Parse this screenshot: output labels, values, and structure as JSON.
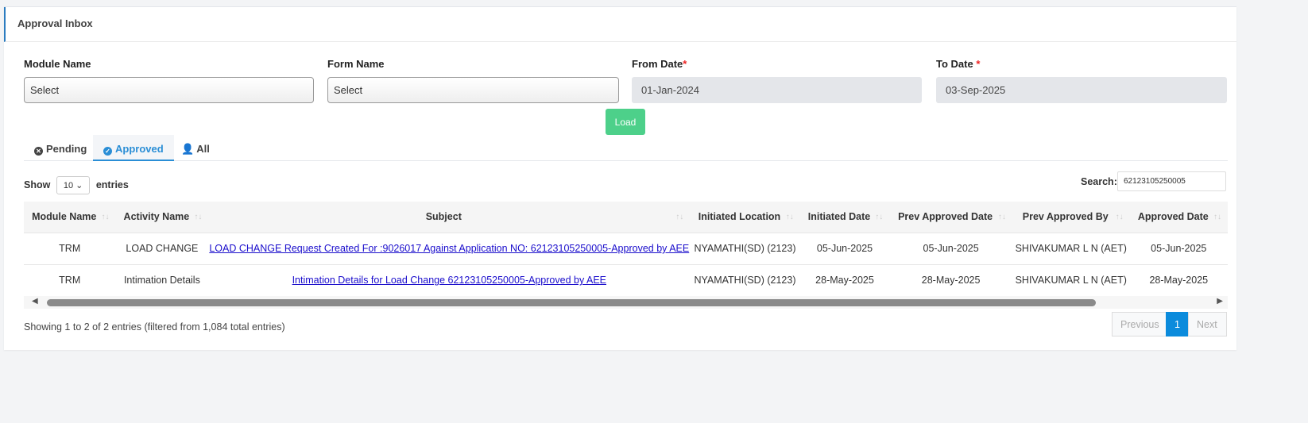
{
  "header": {
    "title": "Approval Inbox"
  },
  "filters": {
    "module_label": "Module Name",
    "module_value": "Select",
    "form_label": "Form Name",
    "form_value": "Select",
    "from_label": "From Date",
    "from_value": "01-Jan-2024",
    "to_label": "To Date",
    "to_value": "03-Sep-2025",
    "required_mark": "*",
    "load_label": "Load"
  },
  "tabs": [
    {
      "label": "Pending",
      "icon": "times-circle-icon"
    },
    {
      "label": "Approved",
      "icon": "check-circle-icon",
      "active": true
    },
    {
      "label": "All",
      "icon": "user-icon"
    }
  ],
  "table_controls": {
    "show_label": "Show",
    "entries_value": "10",
    "entries_label": "entries",
    "search_label": "Search:",
    "search_value": "62123105250005"
  },
  "table": {
    "columns": [
      "Module Name",
      "Activity Name",
      "Subject",
      "Initiated Location",
      "Initiated Date",
      "Prev Approved Date",
      "Prev Approved By",
      "Approved Date"
    ],
    "rows": [
      [
        "TRM",
        "LOAD CHANGE",
        "LOAD CHANGE Request Created For :9026017 Against Application NO: 62123105250005-Approved by AEE",
        "NYAMATHI(SD) (2123)",
        "05-Jun-2025",
        "05-Jun-2025",
        "SHIVAKUMAR L N (AET)",
        "05-Jun-2025"
      ],
      [
        "TRM",
        "Intimation Details",
        "Intimation Details for Load Change 62123105250005-Approved by AEE",
        "NYAMATHI(SD) (2123)",
        "28-May-2025",
        "28-May-2025",
        "SHIVAKUMAR L N (AET)",
        "28-May-2025"
      ]
    ]
  },
  "footer": {
    "info": "Showing 1 to 2 of 2 entries (filtered from 1,084 total entries)",
    "previous": "Previous",
    "page": "1",
    "next": "Next"
  },
  "colors": {
    "accent": "#2a8ed6",
    "load_button": "#4dd08a",
    "page_active": "#0b8bdc"
  }
}
